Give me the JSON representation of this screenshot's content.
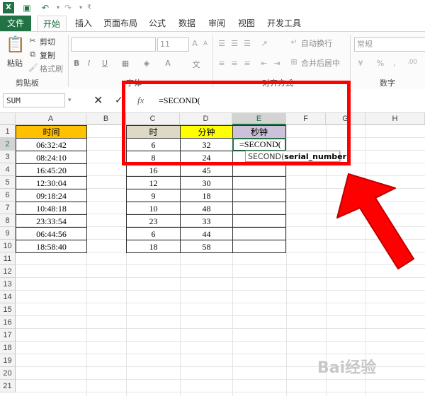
{
  "qat": {
    "excel_icon": "excel-logo-icon",
    "save_icon": "save-icon",
    "undo_icon": "undo-icon",
    "redo_icon": "redo-icon"
  },
  "tabs": {
    "file": "文件",
    "items": [
      "开始",
      "插入",
      "页面布局",
      "公式",
      "数据",
      "审阅",
      "视图",
      "开发工具"
    ],
    "active": "开始"
  },
  "ribbon": {
    "clipboard": {
      "paste": "粘贴",
      "cut": "剪切",
      "copy": "复制",
      "format_painter": "格式刷",
      "group_label": "剪贴板"
    },
    "font": {
      "size": "11",
      "bold": "B",
      "italic": "I",
      "underline": "U",
      "group_label": "字体"
    },
    "alignment": {
      "wrap": "自动换行",
      "merge": "合并后居中",
      "group_label": "对齐方式"
    },
    "number": {
      "format": "常规",
      "group_label": "数字"
    }
  },
  "formula_bar": {
    "name_box": "SUM",
    "cancel": "✕",
    "enter": "✓",
    "fx": "fx",
    "formula": "=SECOND("
  },
  "columns": [
    "A",
    "B",
    "C",
    "D",
    "E",
    "F",
    "G",
    "H"
  ],
  "rows": [
    "1",
    "2",
    "3",
    "4",
    "5",
    "6",
    "7",
    "8",
    "9",
    "10",
    "11",
    "12",
    "13",
    "14",
    "15",
    "16",
    "17",
    "18",
    "19",
    "20",
    "21"
  ],
  "table_time": {
    "header": "时间",
    "values": [
      "06:32:42",
      "08:24:10",
      "16:45:20",
      "12:30:04",
      "09:18:24",
      "10:48:18",
      "23:33:54",
      "06:44:56",
      "18:58:40"
    ]
  },
  "table_hms": {
    "headers": [
      "时",
      "分钟",
      "秒钟"
    ],
    "hours": [
      "6",
      "8",
      "16",
      "12",
      "9",
      "10",
      "23",
      "6",
      "18"
    ],
    "minutes": [
      "32",
      "24",
      "45",
      "30",
      "18",
      "48",
      "33",
      "44",
      "58"
    ],
    "seconds_edit": "=SECOND("
  },
  "tooltip": {
    "func": "SECOND(",
    "arg": "serial_number",
    "close": ")"
  },
  "colors": {
    "accent": "#217346",
    "highlight": "#ff0000"
  }
}
